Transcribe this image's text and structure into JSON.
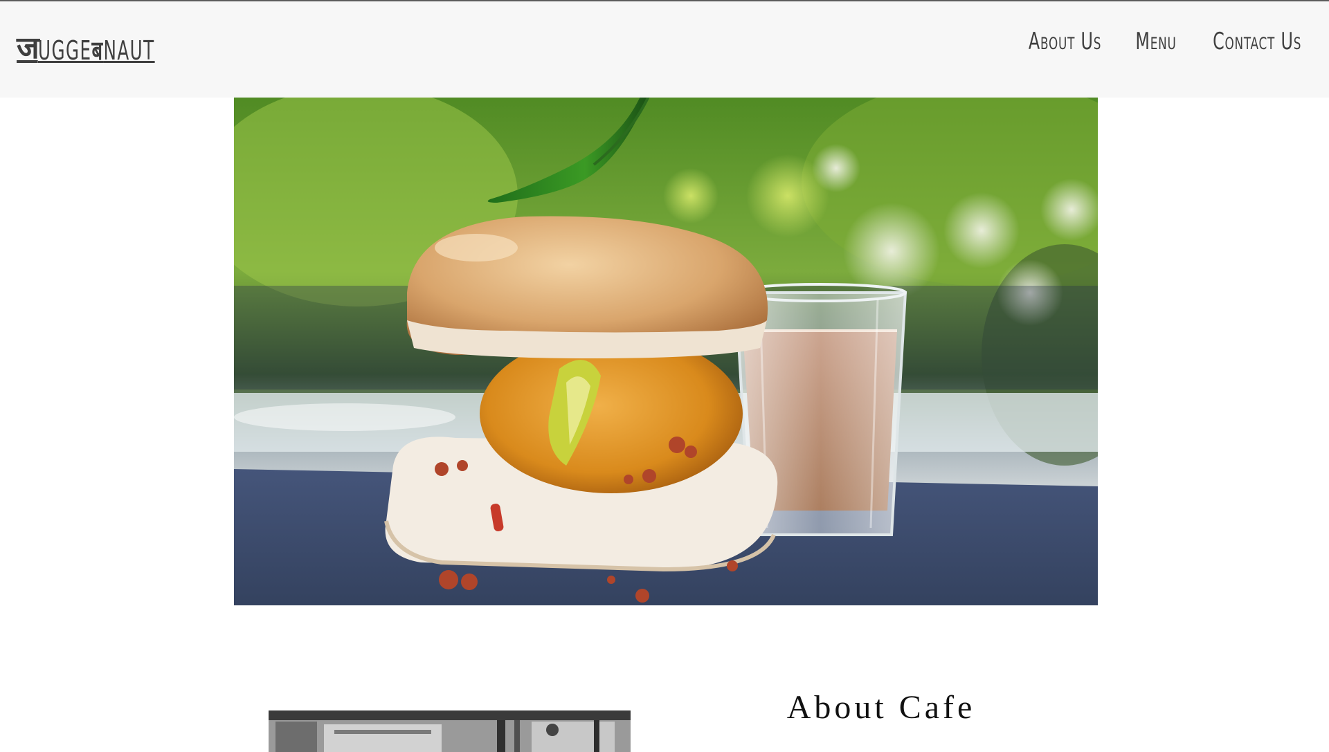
{
  "header": {
    "logo": {
      "devanagari_glyph": "ज",
      "text_part1": "UGGE",
      "devanagari_glyph2": "ब",
      "text_part2": "NAUT"
    },
    "nav": [
      {
        "label": "About Us"
      },
      {
        "label": "Menu"
      },
      {
        "label": "Contact Us"
      }
    ]
  },
  "hero": {
    "image": "vada-pav-with-chai-photo"
  },
  "about": {
    "title": "About Cafe",
    "image": "cafe-interior-bw-photo"
  },
  "colors": {
    "header_bg": "#f7f7f7",
    "header_text": "#3f3f3f",
    "slate": "#3b4a66",
    "bun": "#d9a66f",
    "chai": "#b88a6e"
  }
}
